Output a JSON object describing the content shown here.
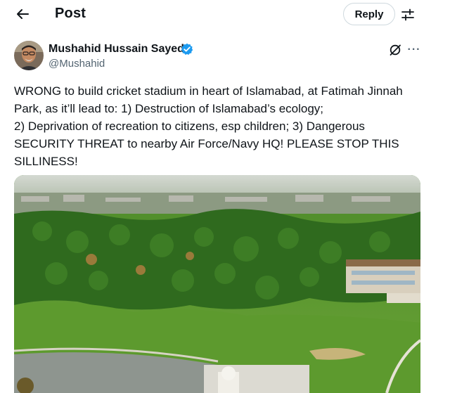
{
  "header": {
    "back_icon": "arrow-left-icon",
    "title": "Post",
    "reply_label": "Reply",
    "settings_icon": "sliders-icon"
  },
  "author": {
    "name": "Mushahid Hussain Sayed",
    "handle": "@Mushahid",
    "verified_icon": "verified-badge-icon",
    "badge_color": "#1d9bf0"
  },
  "actions": {
    "grok_icon": "grok-icon",
    "more_icon": "more-icon",
    "more_glyph": "···"
  },
  "tweet": {
    "text": "WRONG to build cricket stadium in heart of Islamabad, at Fatimah Jinnah\nPark, as it’ll lead to: 1) Destruction of Islamabad’s ecology;\n2) Deprivation of recreation to citizens, esp children; 3) Dangerous\nSECURITY THREAT to nearby Air Force/Navy HQ! PLEASE STOP THIS\nSILLINESS!"
  },
  "media": {
    "kind": "aerial photo of park"
  },
  "colors": {
    "text": "#0f1419",
    "secondary": "#536471",
    "border": "#cfd9de"
  }
}
